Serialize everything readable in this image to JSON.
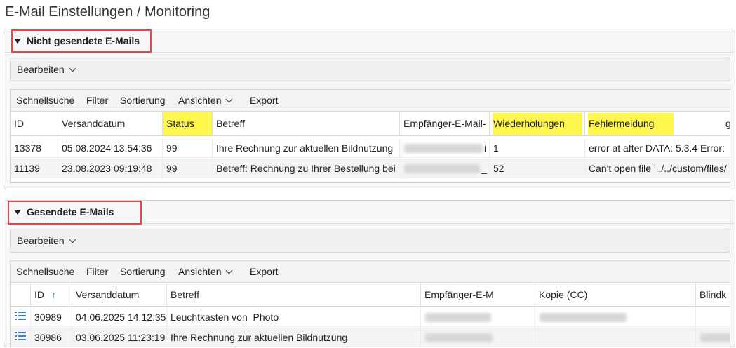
{
  "page_title": "E-Mail Einstellungen / Monitoring",
  "unsent": {
    "section_title": "Nicht gesendete E-Mails",
    "edit_label": "Bearbeiten",
    "toolbar": [
      "Schnellsuche",
      "Filter",
      "Sortierung",
      "Ansichten",
      "Export"
    ],
    "columns": [
      "ID",
      "Versanddatum",
      "Status",
      "Betreff",
      "Empfänger-E-Mail-",
      "Wiederholungen",
      "Fehlermeldung",
      "g"
    ],
    "rows": [
      {
        "id": "13378",
        "date": "05.08.2024 13:54:36",
        "status": "99",
        "subject": "Ihre Rechnung zur aktuellen Bildnutzung",
        "recipient_tail": "i",
        "retries": "1",
        "error": "error at after DATA: 5.3.4 Error:"
      },
      {
        "id": "11139",
        "date": "23.08.2023 09:19:48",
        "status": "99",
        "subject": "Betreff: Rechnung zu Ihrer Bestellung bei",
        "recipient_tail": "_",
        "retries": "52",
        "error": "Can't open file '../../custom/files/"
      }
    ]
  },
  "sent": {
    "section_title": "Gesendete E-Mails",
    "edit_label": "Bearbeiten",
    "toolbar": [
      "Schnellsuche",
      "Filter",
      "Sortierung",
      "Ansichten",
      "Export"
    ],
    "columns": [
      "ID",
      "Versanddatum",
      "Betreff",
      "Empfänger-E-M",
      "Kopie (CC)",
      "Blindk"
    ],
    "sort_indicator": "↑",
    "rows": [
      {
        "id": "30989",
        "date": "04.06.2025 14:12:35",
        "subject": "Leuchtkasten von  Photo"
      },
      {
        "id": "30986",
        "date": "03.06.2025 11:23:19",
        "subject": "Ihre Rechnung zur aktuellen Bildnutzung"
      }
    ]
  },
  "colors": {
    "highlight": "#fff64d",
    "annotation_red": "#e24a4a",
    "icon_blue": "#3a7fd5"
  }
}
